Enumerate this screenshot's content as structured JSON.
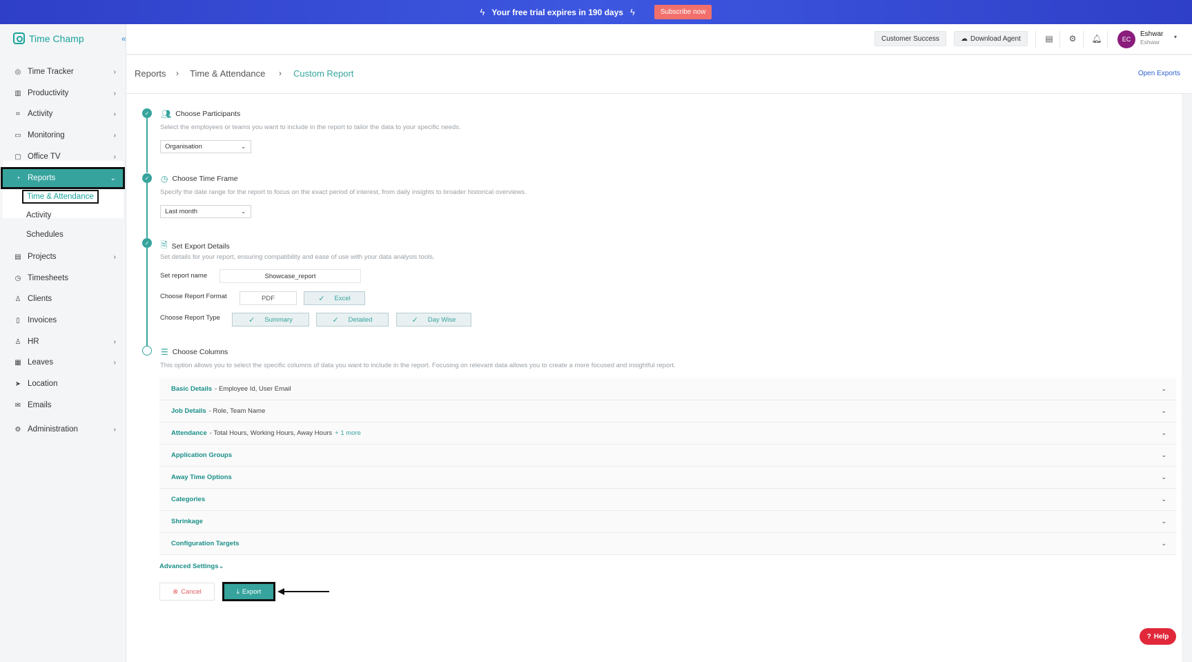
{
  "banner": {
    "message": "Your free trial expires in 190 days",
    "subscribe_label": "Subscribe now"
  },
  "brand": {
    "name": "Time Champ"
  },
  "sidebar": {
    "items": [
      {
        "label": "Time Tracker",
        "icon": "clock-icon",
        "has_chevron": true
      },
      {
        "label": "Productivity",
        "icon": "chart-icon",
        "has_chevron": true
      },
      {
        "label": "Activity",
        "icon": "activity-icon",
        "has_chevron": true
      },
      {
        "label": "Monitoring",
        "icon": "monitor-icon",
        "has_chevron": true
      },
      {
        "label": "Office TV",
        "icon": "tv-icon",
        "has_chevron": true
      },
      {
        "label": "Reports",
        "icon": "reports-icon",
        "has_chevron": true
      },
      {
        "label": "Projects",
        "icon": "briefcase-icon",
        "has_chevron": true
      },
      {
        "label": "Timesheets",
        "icon": "timer-icon",
        "has_chevron": false
      },
      {
        "label": "Clients",
        "icon": "user-icon",
        "has_chevron": false
      },
      {
        "label": "Invoices",
        "icon": "invoice-icon",
        "has_chevron": false
      },
      {
        "label": "HR",
        "icon": "person-icon",
        "has_chevron": true
      },
      {
        "label": "Leaves",
        "icon": "calendar-icon",
        "has_chevron": true
      },
      {
        "label": "Location",
        "icon": "location-icon",
        "has_chevron": false
      },
      {
        "label": "Emails",
        "icon": "mail-icon",
        "has_chevron": false
      },
      {
        "label": "Administration",
        "icon": "gear-icon",
        "has_chevron": true
      }
    ],
    "reports_sub": [
      "Time & Attendance",
      "Activity",
      "Schedules"
    ]
  },
  "header": {
    "customer_success": "Customer Success",
    "download_agent": "Download Agent",
    "user_initials": "EC",
    "user_name": "Eshwar",
    "user_sub": "Eshwar"
  },
  "breadcrumb": {
    "items": [
      "Reports",
      "Time & Attendance",
      "Custom Report"
    ],
    "open_exports": "Open Exports"
  },
  "steps": {
    "participants": {
      "title": "Choose Participants",
      "desc": "Select the employees or teams you want to include in the report to tailor the data to your specific needs.",
      "value": "Organisation"
    },
    "timeframe": {
      "title": "Choose Time Frame",
      "desc": "Specify the date range for the report to focus on the exact period of interest, from daily insights to broader historical overviews.",
      "value": "Last month"
    },
    "export": {
      "title": "Set Export Details",
      "desc": "Set details for your report, ensuring compatibility and ease of use with your data analysis tools.",
      "name_label": "Set report name",
      "name_value": "Showcase_report",
      "format_label": "Choose Report Format",
      "formats": [
        {
          "label": "PDF",
          "selected": false
        },
        {
          "label": "Excel",
          "selected": true
        }
      ],
      "type_label": "Choose Report Type",
      "types": [
        {
          "label": "Summary",
          "selected": true
        },
        {
          "label": "Detailed",
          "selected": true
        },
        {
          "label": "Day Wise",
          "selected": true
        }
      ]
    },
    "columns": {
      "title": "Choose Columns",
      "desc": "This option allows you to select the specific columns of data you want to include in the report. Focusing on relevant data allows you to create a more focused and insightful report.",
      "groups": [
        {
          "title": "Basic Details",
          "detail": "- Employee Id, User Email",
          "more": ""
        },
        {
          "title": "Job Details",
          "detail": "- Role, Team Name",
          "more": ""
        },
        {
          "title": "Attendance",
          "detail": "- Total Hours, Working Hours, Away Hours",
          "more": "+ 1 more"
        },
        {
          "title": "Application Groups",
          "detail": "",
          "more": ""
        },
        {
          "title": "Away Time Options",
          "detail": "",
          "more": ""
        },
        {
          "title": "Categories",
          "detail": "",
          "more": ""
        },
        {
          "title": "Shrinkage",
          "detail": "",
          "more": ""
        },
        {
          "title": "Configuration Targets",
          "detail": "",
          "more": ""
        }
      ]
    }
  },
  "actions": {
    "advanced": "Advanced Settings",
    "cancel": "Cancel",
    "export": "Export"
  },
  "help": {
    "label": "Help"
  },
  "colors": {
    "accent": "#36a49d",
    "banner": "#3d57e0",
    "subscribe": "#f2706b",
    "help": "#e0283a"
  }
}
